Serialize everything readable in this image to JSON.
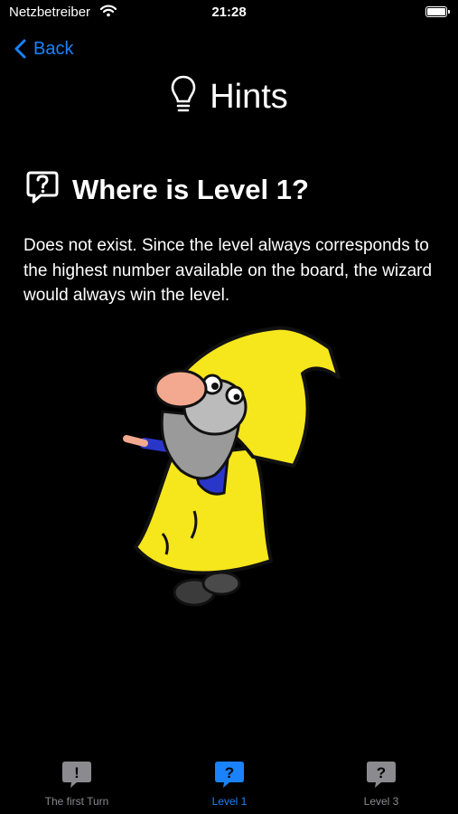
{
  "status_bar": {
    "carrier": "Netzbetreiber",
    "time": "21:28"
  },
  "nav": {
    "back_label": "Back"
  },
  "page": {
    "title": "Hints",
    "title_icon": "lightbulb-icon"
  },
  "hint": {
    "icon": "question-bubble-icon",
    "heading": "Where is Level 1?",
    "body": "Does not exist. Since the level always corresponds to the highest number available on the board, the wizard would always win the level."
  },
  "tabs": [
    {
      "label": "The first Turn",
      "glyph": "!",
      "active": false
    },
    {
      "label": "Level 1",
      "glyph": "?",
      "active": true
    },
    {
      "label": "Level 3",
      "glyph": "?",
      "active": false
    }
  ],
  "colors": {
    "accent": "#1a82fb",
    "inactive": "#8b8b8f",
    "background": "#000000",
    "wizard_hat": "#f6e61c"
  }
}
